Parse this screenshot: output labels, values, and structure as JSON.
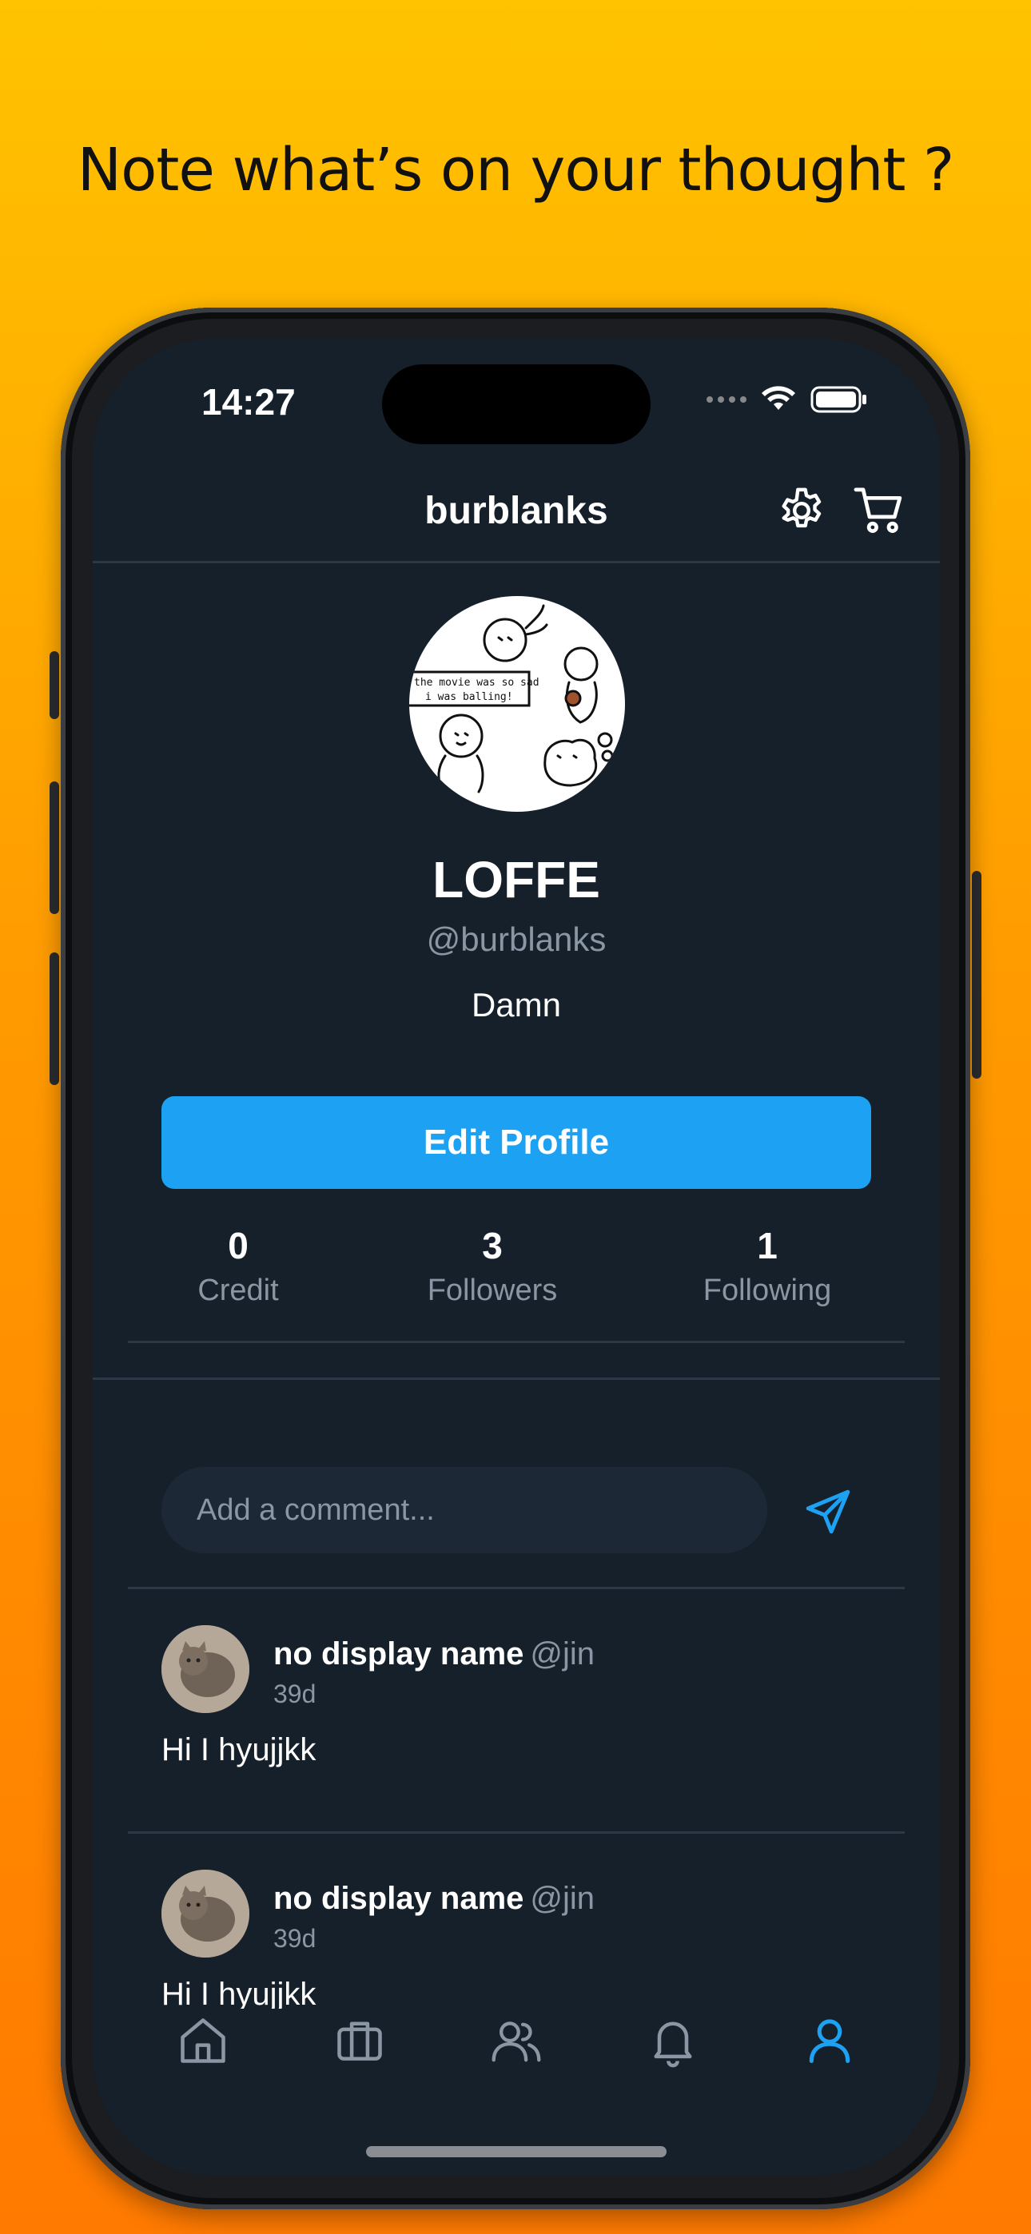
{
  "banner": {
    "headline": "Note what’s on your thought ?"
  },
  "status_bar": {
    "time": "14:27"
  },
  "header": {
    "title": "burblanks",
    "settings_icon": "gear-icon",
    "cart_icon": "cart-icon"
  },
  "profile": {
    "display_name": "LOFFE",
    "handle": "@burblanks",
    "bio": "Damn",
    "avatar_caption": "the movie was so sad i was balling!",
    "edit_button": "Edit Profile"
  },
  "stats": [
    {
      "value": "0",
      "label": "Credit"
    },
    {
      "value": "3",
      "label": "Followers"
    },
    {
      "value": "1",
      "label": "Following"
    }
  ],
  "comment_input": {
    "placeholder": "Add a comment...",
    "send_icon": "send-icon"
  },
  "posts": [
    {
      "name": "no display name",
      "handle": "@jin",
      "time": "39d",
      "text": "Hi I hyujjkk"
    },
    {
      "name": "no display name",
      "handle": "@jin",
      "time": "39d",
      "text": "Hi I hyujjkk"
    }
  ],
  "tab_bar": {
    "items": [
      "home-icon",
      "briefcase-icon",
      "users-icon",
      "bell-icon",
      "profile-icon"
    ],
    "active": "profile-icon",
    "active_color": "#1DA1F2",
    "inactive_color": "#8a96a3"
  },
  "colors": {
    "background": "#15202B",
    "accent": "#1DA1F2"
  }
}
